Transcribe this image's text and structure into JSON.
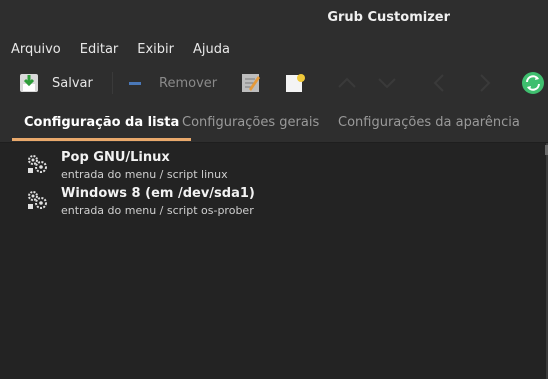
{
  "window": {
    "title": "Grub Customizer"
  },
  "menu": {
    "items": [
      "Arquivo",
      "Editar",
      "Exibir",
      "Ajuda"
    ]
  },
  "toolbar": {
    "save_label": "Salvar",
    "remove_label": "Remover"
  },
  "tabs": [
    "Configuração da lista",
    "Configurações gerais",
    "Configurações da aparência"
  ],
  "entries": [
    {
      "name": "Pop GNU/Linux",
      "detail": "entrada do menu / script linux"
    },
    {
      "name": "Windows 8 (em /dev/sda1)",
      "detail": "entrada do menu / script os-prober"
    }
  ],
  "colors": {
    "accent": "#e9a96c",
    "background": "#232323",
    "refresh": "#3fbf6f"
  }
}
